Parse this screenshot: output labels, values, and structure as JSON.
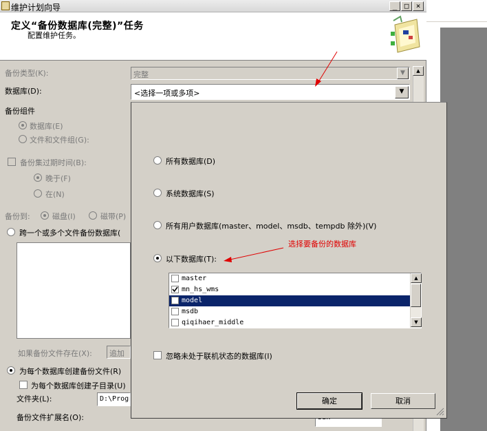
{
  "window": {
    "title": "维护计划向导",
    "minimize": "_",
    "maximize": "□",
    "close": "×"
  },
  "header": {
    "title": "定义“备份数据库(完整)”任务",
    "subtitle": "配置维护任务。"
  },
  "form": {
    "backup_type_label": "备份类型(K):",
    "backup_type_value": "完整",
    "databases_label": "数据库(D):",
    "databases_value": "<选择一项或多项>",
    "backup_component_label": "备份组件",
    "component_database": "数据库(E)",
    "component_files": "文件和文件组(G):",
    "backup_set_expire": "备份集过期时间(B):",
    "expire_after": "晚于(F)",
    "expire_on": "在(N)",
    "backup_to_label": "备份到:",
    "backup_to_disk": "磁盘(I)",
    "backup_to_tape": "磁带(P)",
    "span_files": "跨一个或多个文件备份数据库(",
    "if_exists_label": "如果备份文件存在(X):",
    "if_exists_value": "追加",
    "create_per_db": "为每个数据库创建备份文件(R)",
    "create_subdir": "为每个数据库创建子目录(U)",
    "folder_label": "文件夹(L):",
    "folder_value": "D:\\Progr",
    "ext_label": "备份文件扩展名(O):",
    "ext_value": "bak"
  },
  "popup": {
    "all_databases": "所有数据库(D)",
    "system_databases": "系统数据库(S)",
    "user_databases": "所有用户数据库(master、model、msdb、tempdb 除外)(V)",
    "these_databases": "以下数据库(T):",
    "database_list": [
      {
        "name": "master",
        "checked": false,
        "selected": false
      },
      {
        "name": "mn_hs_wms",
        "checked": true,
        "selected": false
      },
      {
        "name": "model",
        "checked": false,
        "selected": true
      },
      {
        "name": "msdb",
        "checked": false,
        "selected": false
      },
      {
        "name": "qiqihaer_middle",
        "checked": false,
        "selected": false
      }
    ],
    "ignore_offline": "忽略未处于联机状态的数据库(I)",
    "ok": "确定",
    "cancel": "取消"
  },
  "annotation": {
    "text": "选择要备份的数据库",
    "color": "#e00000"
  }
}
